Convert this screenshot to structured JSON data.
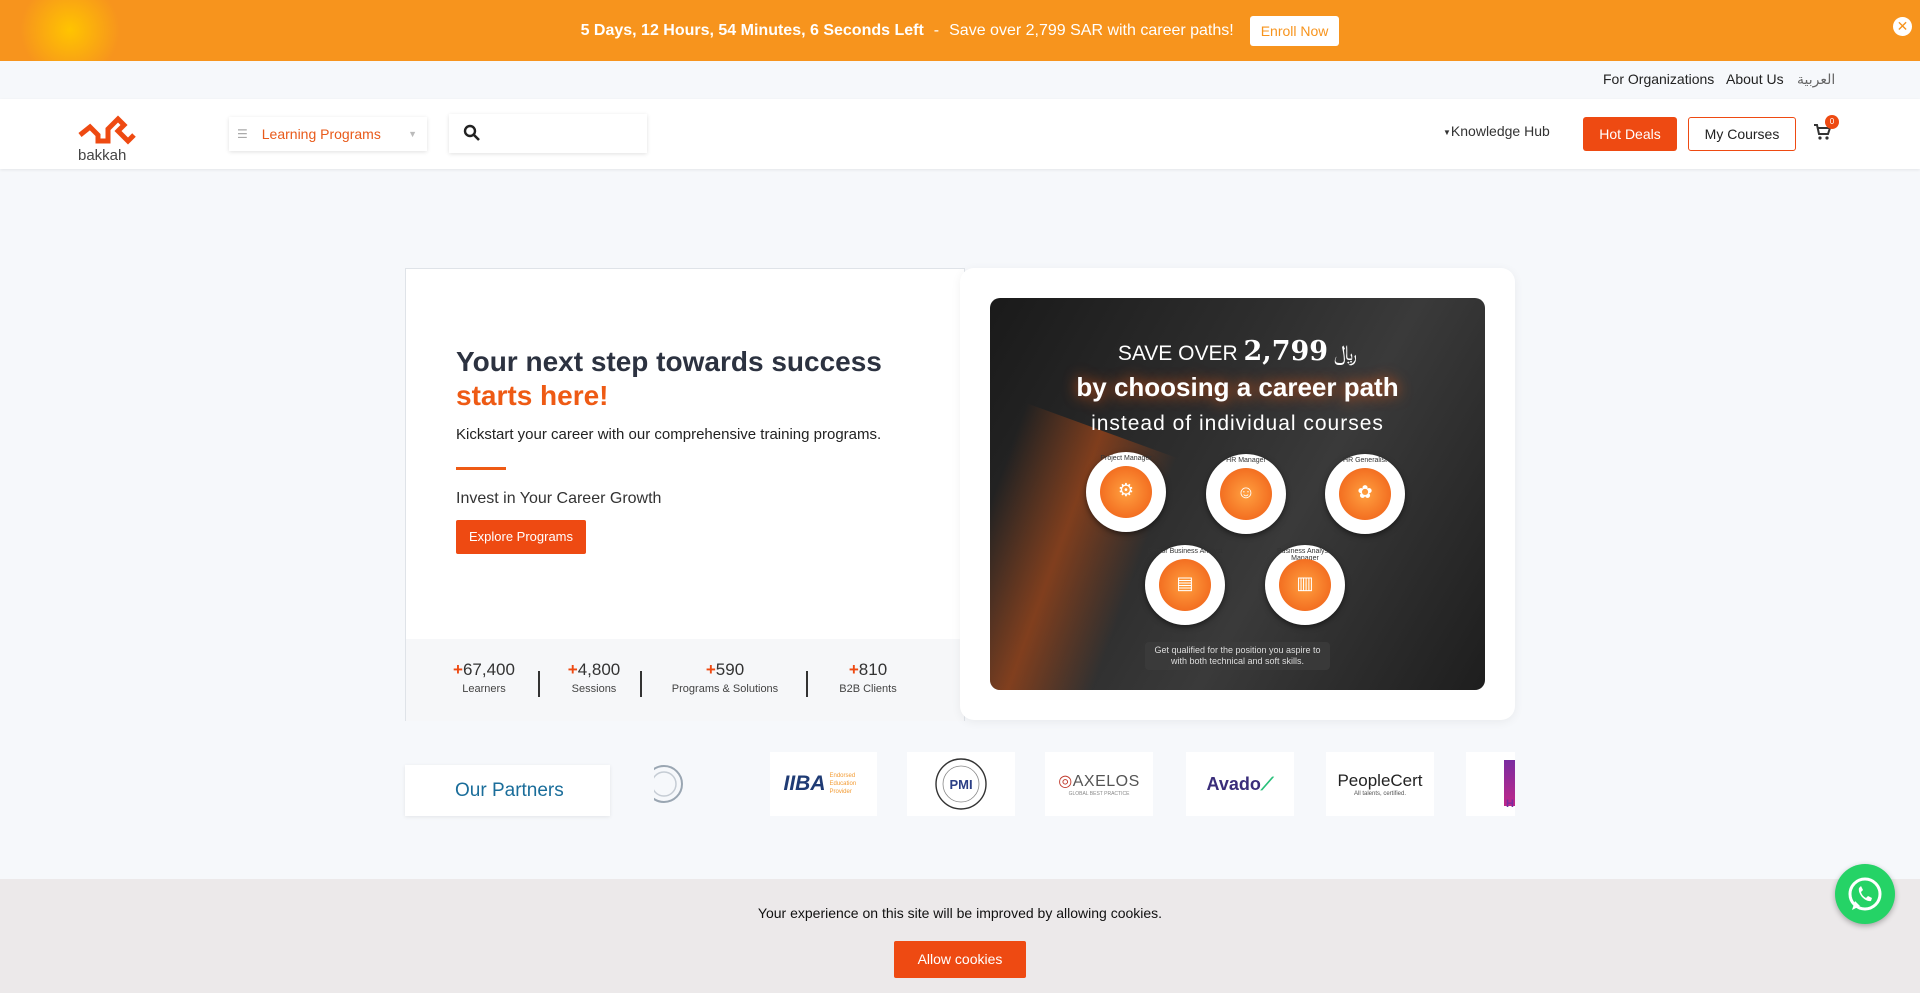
{
  "promo_bar": {
    "countdown": "5 Days, 12 Hours, 54 Minutes, 6 Seconds Left",
    "separator": "-",
    "message": "Save over 2,799 SAR with career paths!",
    "enroll_label": "Enroll Now",
    "close_icon": "close-icon",
    "background": "#f7941d"
  },
  "top_links": {
    "organizations": "For Organizations",
    "about": "About Us",
    "language": "العربية"
  },
  "header": {
    "logo_text": "bakkah",
    "programs_label": "Learning Programs",
    "knowledge_hub": "Knowledge Hub",
    "hot_deals": "Hot Deals",
    "my_courses": "My Courses",
    "cart_count": "0",
    "accent": "#ee4a12"
  },
  "hero": {
    "title": "Your next step towards success",
    "title_accent": "starts here!",
    "subtitle": "Kickstart your career with our comprehensive training programs.",
    "invest": "Invest in Your Career Growth",
    "cta": "Explore Programs",
    "stats": [
      {
        "plus": "+",
        "value": "67,400",
        "label": "Learners"
      },
      {
        "plus": "+",
        "value": "4,800",
        "label": "Sessions"
      },
      {
        "plus": "+",
        "value": "590",
        "label": "Programs & Solutions"
      },
      {
        "plus": "+",
        "value": "810",
        "label": "B2B Clients"
      }
    ]
  },
  "promo_image": {
    "save_prefix": "SAVE OVER",
    "save_amount": "2,799",
    "currency_symbol": "⃁",
    "choose": "by choosing a career path",
    "instead": "instead of individual courses",
    "badges": [
      {
        "label": "Project Manager",
        "glyph": "⚙"
      },
      {
        "label": "HR Manager",
        "glyph": "☺"
      },
      {
        "label": "HR Generalist",
        "glyph": "✿"
      },
      {
        "label": "Senior Business Analyst",
        "glyph": "▤"
      },
      {
        "label": "Business Analysis Manager",
        "glyph": "▥"
      }
    ],
    "footnote_line1": "Get qualified for the position you aspire to",
    "footnote_line2": "with both technical and soft skills."
  },
  "partners": {
    "label": "Our Partners",
    "logos": [
      "",
      "IIBA",
      "PMI",
      "AXELOS",
      "Avado",
      "PeopleCert",
      "H"
    ],
    "logo_captions": {
      "iiba_sub": "Endorsed Education Provider",
      "axelos_sub": "GLOBAL BEST PRACTICE",
      "peoplecert_sub": "All talents, certified."
    }
  },
  "cookies": {
    "message": "Your experience on this site will be improved by allowing cookies.",
    "button": "Allow cookies"
  }
}
